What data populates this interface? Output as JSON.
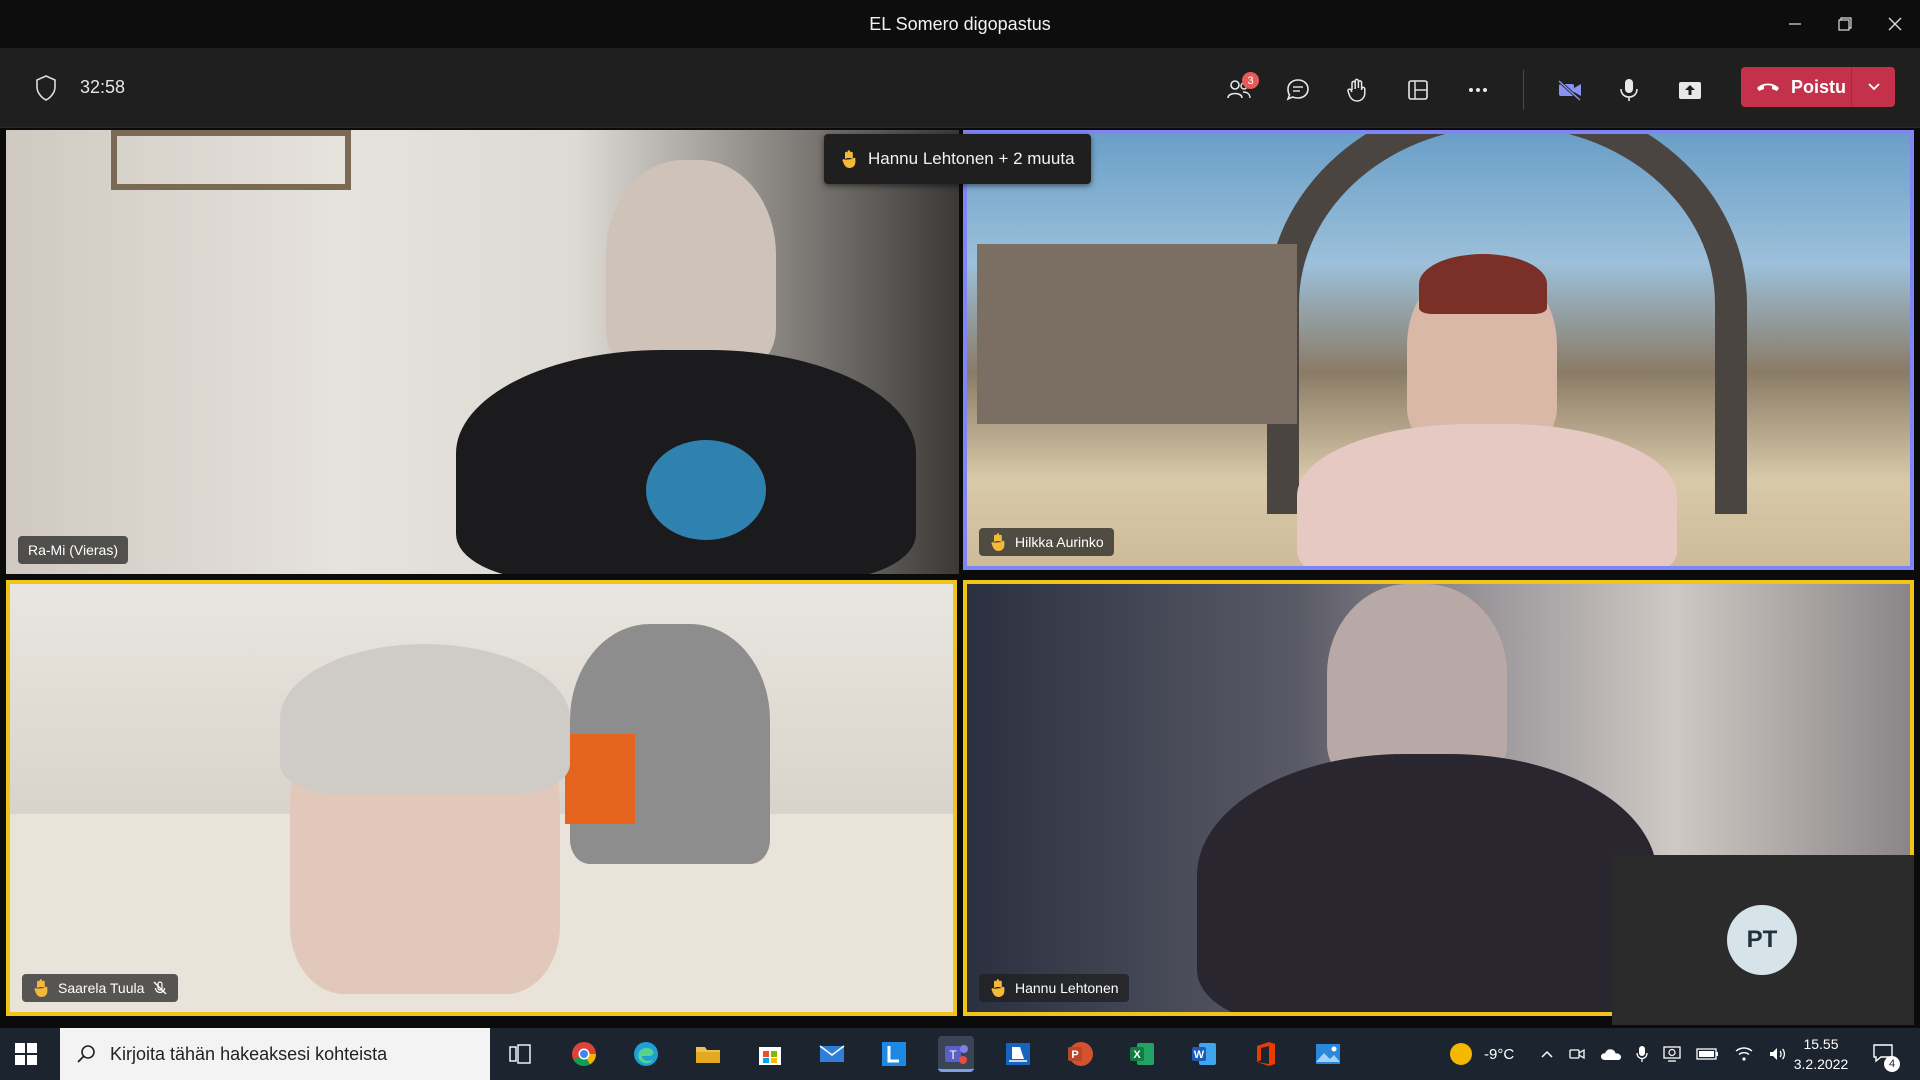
{
  "window": {
    "title": "EL Somero digopastus"
  },
  "toolbar": {
    "timer": "32:58",
    "participants_badge": "3",
    "leave_label": "Poistu"
  },
  "raised_hands_banner": "Hannu Lehtonen + 2 muuta",
  "tiles": [
    {
      "name": "Ra-Mi (Vieras)",
      "hand_raised": false,
      "muted": false
    },
    {
      "name": "Hilkka Aurinko",
      "hand_raised": true,
      "muted": false,
      "speaking": true
    },
    {
      "name": "Saarela Tuula",
      "hand_raised": true,
      "muted": true
    },
    {
      "name": "Hannu Lehtonen",
      "hand_raised": true,
      "muted": false
    }
  ],
  "self_view": {
    "initials": "PT"
  },
  "taskbar": {
    "search_placeholder": "Kirjoita tähän hakeaksesi kohteista",
    "weather": "-9°C",
    "time": "15.55",
    "date": "3.2.2022",
    "notifications": "4"
  },
  "colors": {
    "speaking_border": "#7f85f5",
    "hand_border": "#f0c419",
    "leave_button": "#c4314b",
    "badge": "#e85a5a"
  }
}
